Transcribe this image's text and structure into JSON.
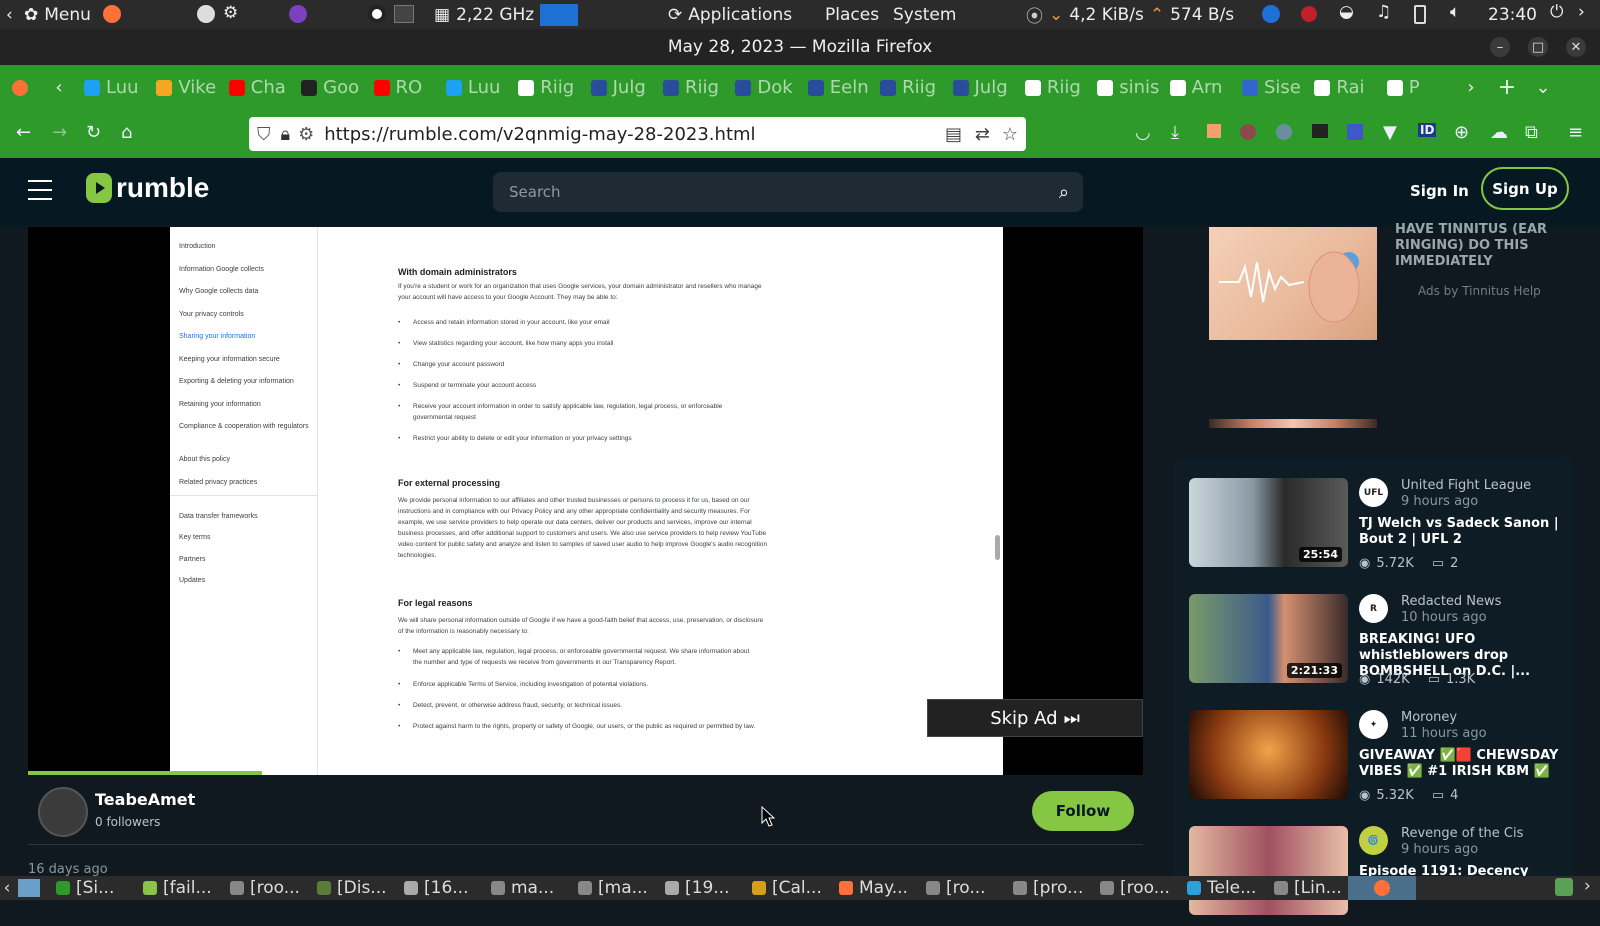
{
  "system_panel": {
    "menu": "Menu",
    "cpu": "2,22 GHz",
    "applications": "Applications",
    "places": "Places",
    "system": "System",
    "net_down": "4,2 KiB/s",
    "net_up": "574 B/s",
    "clock": "23:40"
  },
  "window": {
    "title": "May 28, 2023 — Mozilla Firefox"
  },
  "tabs": [
    {
      "label": "Luu",
      "color": "#1da1f2"
    },
    {
      "label": "Vike",
      "color": "#f5a623"
    },
    {
      "label": "Cha",
      "color": "#ff0000"
    },
    {
      "label": "Goo",
      "color": "#222222"
    },
    {
      "label": "RO",
      "color": "#ff0000"
    },
    {
      "label": "Luu",
      "color": "#1da1f2"
    },
    {
      "label": "Riig",
      "color": "#ffffff"
    },
    {
      "label": "Julg",
      "color": "#2a4d9b"
    },
    {
      "label": "Riig",
      "color": "#2a4d9b"
    },
    {
      "label": "Dok",
      "color": "#2a4d9b"
    },
    {
      "label": "Eeln",
      "color": "#2a4d9b"
    },
    {
      "label": "Riig",
      "color": "#2a4d9b"
    },
    {
      "label": "Julg",
      "color": "#2a4d9b"
    },
    {
      "label": "Riig",
      "color": "#ffffff"
    },
    {
      "label": "sinis",
      "color": "#ffffff"
    },
    {
      "label": "Arn",
      "color": "#ffffff"
    },
    {
      "label": "Sise",
      "color": "#3366cc"
    },
    {
      "label": "Rai",
      "color": "#ffffff"
    },
    {
      "label": "P",
      "color": "#ffffff"
    }
  ],
  "nav": {
    "url": "https://rumble.com/v2qnmig-may-28-2023.html"
  },
  "rumble": {
    "logo": "rumble",
    "search_placeholder": "Search",
    "sign_in": "Sign In",
    "sign_up": "Sign Up"
  },
  "video_doc": {
    "sidebar": [
      "Introduction",
      "Information Google collects",
      "Why Google collects data",
      "Your privacy controls",
      "Sharing your information",
      "Keeping your information secure",
      "Exporting & deleting your information",
      "Retaining your information",
      "Compliance & cooperation with regulators",
      "About this policy",
      "Related privacy practices",
      "Data transfer frameworks",
      "Key terms",
      "Partners",
      "Updates"
    ],
    "h1": "With domain administrators",
    "p1": "If you're a student or work for an organization that uses Google services, your domain administrator and resellers who manage your account will have access to your Google Account. They may be able to:",
    "bullets1": [
      "Access and retain information stored in your account, like your email",
      "View statistics regarding your account, like how many apps you install",
      "Change your account password",
      "Suspend or terminate your account access",
      "Receive your account information in order to satisfy applicable law, regulation, legal process, or enforceable governmental request",
      "Restrict your ability to delete or edit your information or your privacy settings"
    ],
    "h2": "For external processing",
    "p2": "We provide personal information to our affiliates and other trusted businesses or persons to process it for us, based on our instructions and in compliance with our Privacy Policy and any other appropriate confidentiality and security measures. For example, we use service providers to help operate our data centers, deliver our products and services, improve our internal business processes, and offer additional support to customers and users. We also use service providers to help review YouTube video content for public safety and analyze and listen to samples of saved user audio to help improve Google's audio recognition technologies.",
    "h3": "For legal reasons",
    "p3": "We will share personal information outside of Google if we have a good-faith belief that access, use, preservation, or disclosure of the information is reasonably necessary to:",
    "bullets3": [
      "Meet any applicable law, regulation, legal process, or enforceable governmental request. We share information about the number and type of requests we receive from governments in our Transparency Report.",
      "Enforce applicable Terms of Service, including investigation of potential violations.",
      "Detect, prevent, or otherwise address fraud, security, or technical issues.",
      "Protect against harm to the rights, property or safety of Google, our users, or the public as required or permitted by law."
    ]
  },
  "player": {
    "skip_ad": "Skip Ad",
    "progress": 0.21
  },
  "channel": {
    "name": "TeabeAmet",
    "followers": "0 followers",
    "follow": "Follow",
    "date": "16 days ago"
  },
  "ad": {
    "text": "HAVE TINNITUS (EAR RINGING) DO THIS IMMEDIATELY",
    "by": "Ads by Tinnitus Help"
  },
  "recommended": [
    {
      "channel": "United Fight League",
      "ago": "9 hours ago",
      "title": "TJ Welch vs Sadeck Sanon | Bout 2 | UFL 2",
      "duration": "25:54",
      "views": "5.72K",
      "comments": "2"
    },
    {
      "channel": "Redacted News",
      "ago": "10 hours ago",
      "title": "BREAKING! UFO whistleblowers drop BOMBSHELL on D.C. |...",
      "duration": "2:21:33",
      "views": "142K",
      "comments": "1.3K"
    },
    {
      "channel": "Moroney",
      "ago": "11 hours ago",
      "title": "GIVEAWAY ✅🟥 CHEWSDAY VIBES ✅ #1 IRISH KBM ✅",
      "duration": "",
      "views": "5.32K",
      "comments": "4"
    },
    {
      "channel": "Revenge of the Cis",
      "ago": "9 hours ago",
      "title": "Episode 1191: Decency",
      "duration": "",
      "views": "",
      "comments": ""
    }
  ],
  "taskbar": [
    {
      "label": "[Si...",
      "color": "#2e9a2a"
    },
    {
      "label": "[fail...",
      "color": "#8bc34a"
    },
    {
      "label": "[roo...",
      "color": "#888888"
    },
    {
      "label": "[Dis...",
      "color": "#5c7a3a"
    },
    {
      "label": "[16...",
      "color": "#aaaaaa"
    },
    {
      "label": "ma...",
      "color": "#888888"
    },
    {
      "label": "[ma...",
      "color": "#888888"
    },
    {
      "label": "[19...",
      "color": "#aaaaaa"
    },
    {
      "label": "[Cal...",
      "color": "#d4a017"
    },
    {
      "label": "May...",
      "color": "#ff7139"
    },
    {
      "label": "[ro...",
      "color": "#888888"
    },
    {
      "label": "[pro...",
      "color": "#888888"
    },
    {
      "label": "[roo...",
      "color": "#888888"
    },
    {
      "label": "Tele...",
      "color": "#2aa1da"
    },
    {
      "label": "[Lin...",
      "color": "#888888"
    }
  ]
}
